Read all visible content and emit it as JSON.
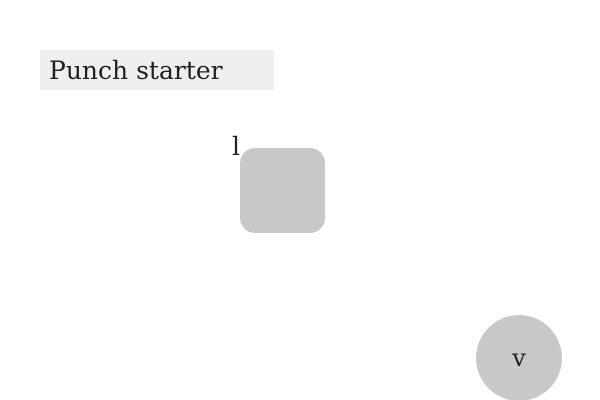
{
  "title": {
    "text": "Punch starter"
  },
  "small_label": {
    "text": "l"
  },
  "buttons": {
    "square": {
      "label": ""
    },
    "circle": {
      "label": "v"
    }
  },
  "colors": {
    "background": "#ffffff",
    "title_background": "#efefef",
    "button_fill": "#c8c8c8",
    "text": "#222222"
  }
}
